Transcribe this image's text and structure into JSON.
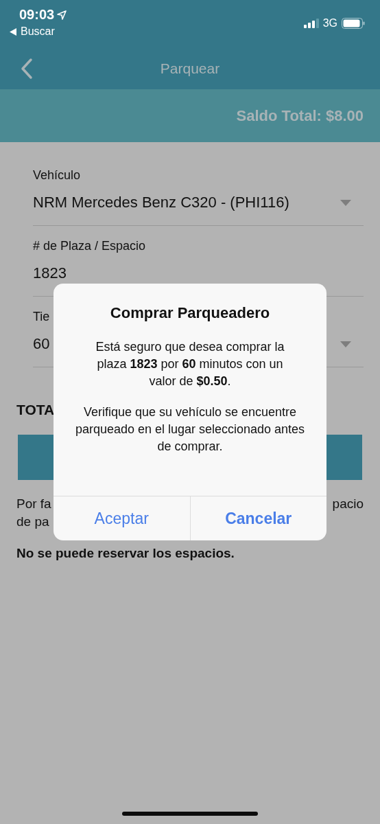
{
  "status_bar": {
    "time": "09:03",
    "back_app": "Buscar",
    "network": "3G"
  },
  "nav": {
    "title": "Parquear"
  },
  "balance": {
    "text": "Saldo Total: $8.00"
  },
  "fields": [
    {
      "kind": "select",
      "label": "Vehículo",
      "value": "NRM Mercedes Benz C320 - (PHI116)"
    },
    {
      "kind": "text",
      "label": "# de Plaza / Espacio",
      "value": "1823"
    },
    {
      "kind": "select",
      "label": "Tie",
      "value": "60"
    }
  ],
  "total": {
    "label": "TOTA"
  },
  "note": {
    "line1_left": "Por fa",
    "line1_right": "pacio",
    "line2": "de pa"
  },
  "warning": "No se puede reservar los espacios.",
  "dialog": {
    "title": "Comprar Parqueadero",
    "message": "Está seguro que desea comprar la plaza **1823** por **60** minutos con un valor de **$0.50**.",
    "detail": "Verifique que su vehículo se encuentre parqueado en el lugar seleccionado antes de comprar.",
    "buttons": [
      {
        "label": "Aceptar",
        "kind": "normal"
      },
      {
        "label": "Cancelar",
        "kind": "preferred"
      }
    ]
  }
}
